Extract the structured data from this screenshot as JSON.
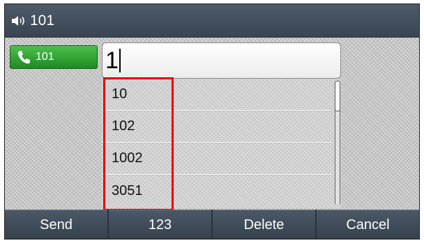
{
  "titlebar": {
    "icon": "speaker-icon",
    "title": "101"
  },
  "line_key": {
    "icon": "phone-handset-icon",
    "label": "101",
    "color": "#1f8a24"
  },
  "dial_input": {
    "value": "1"
  },
  "suggestions": [
    "10",
    "102",
    "1002",
    "3051"
  ],
  "highlight_color": "#e60000",
  "softkeys": [
    "Send",
    "123",
    "Delete",
    "Cancel"
  ]
}
